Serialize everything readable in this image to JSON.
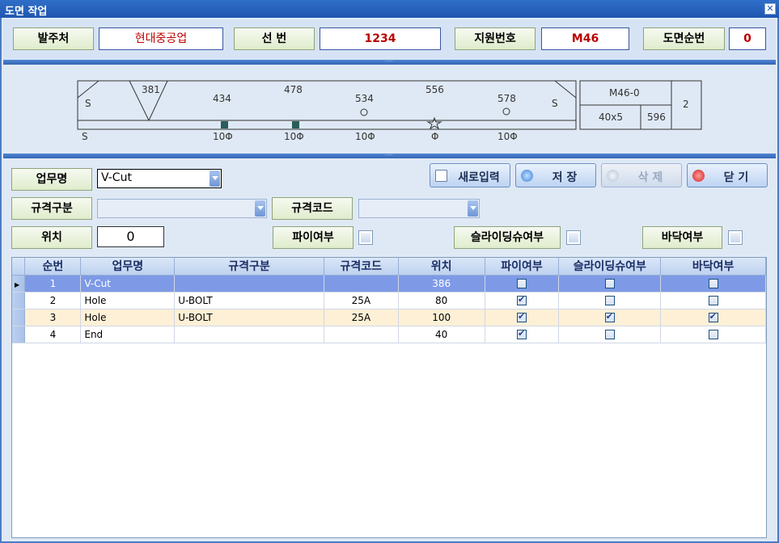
{
  "window": {
    "title": "도면 작업",
    "close_glyph": "✕"
  },
  "header": {
    "orderer_label": "발주처",
    "orderer_value": "현대중공업",
    "ship_label": "선  번",
    "ship_value": "1234",
    "support_label": "지원번호",
    "support_value": "M46",
    "drawing_seq_label": "도면순번",
    "drawing_seq_value": "0"
  },
  "drawing": {
    "top_labels": [
      "381",
      "434",
      "478",
      "534",
      "556",
      "578"
    ],
    "side_labels": [
      "S",
      "S",
      "S"
    ],
    "bottom_labels": [
      "10Φ",
      "10Φ",
      "10Φ",
      "Φ",
      "10Φ"
    ],
    "info_box": {
      "code": "M46-0",
      "size": "40x5",
      "length": "596",
      "qty": "2"
    }
  },
  "form": {
    "task_label": "업무명",
    "task_value": "V-Cut",
    "spec_type_label": "규격구분",
    "spec_code_label": "규격코드",
    "position_label": "위치",
    "position_value": "0",
    "pipe_label": "파이여부",
    "sliding_label": "슬라이딩슈여부",
    "floor_label": "바닥여부"
  },
  "buttons": {
    "new": "새로입력",
    "save": "저  장",
    "delete": "삭  제",
    "close": "닫  기"
  },
  "grid": {
    "columns": [
      "순번",
      "업무명",
      "규격구분",
      "규격코드",
      "위치",
      "파이여부",
      "슬라이딩슈여부",
      "바닥여부"
    ],
    "rows": [
      {
        "seq": "1",
        "task": "V-Cut",
        "spec_type": "",
        "spec_code": "",
        "pos": "386",
        "pipe": false,
        "sliding": false,
        "floor": false
      },
      {
        "seq": "2",
        "task": "Hole",
        "spec_type": "U-BOLT",
        "spec_code": "25A",
        "pos": "80",
        "pipe": true,
        "sliding": false,
        "floor": false
      },
      {
        "seq": "3",
        "task": "Hole",
        "spec_type": "U-BOLT",
        "spec_code": "25A",
        "pos": "100",
        "pipe": true,
        "sliding": true,
        "floor": true
      },
      {
        "seq": "4",
        "task": "End",
        "spec_type": "",
        "spec_code": "",
        "pos": "40",
        "pipe": true,
        "sliding": false,
        "floor": false
      }
    ]
  }
}
